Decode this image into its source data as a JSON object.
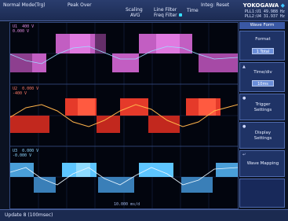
{
  "topbar": {
    "mode": "Normal Mode(Trg)",
    "peak": "Peak Over",
    "scaling": "Scaling",
    "avg": "AVG",
    "line_filter": "Line Filter",
    "freq_filter": "Freq Filter",
    "time": "Time",
    "integ": "Integ: Reset",
    "brand": "YOKOGAWA",
    "pll1": "PLL1:U1   49.988 Hz",
    "pll2": "PLL2:U4   31.937 Hz"
  },
  "channels": [
    {
      "name": "U1",
      "top_value": "400 V",
      "bottom_value": "0.000 V",
      "color": "#d25ad2"
    },
    {
      "name": "U2",
      "top_value": "0.000 V",
      "bottom_value": "-400 V",
      "color": "#ff3b2e"
    },
    {
      "name": "U3",
      "top_value": "0.000 V",
      "bottom_value": "-0.000 V",
      "color": "#5ec6ff"
    }
  ],
  "menu": {
    "title": "Wave Form",
    "items": [
      {
        "label": "Format",
        "value": "1 Total"
      },
      {
        "label": "Time/div",
        "value": "10ms"
      },
      {
        "label": "Trigger\nSettings"
      },
      {
        "label": "Display\nSettings"
      },
      {
        "label": "Wave Mapping"
      }
    ]
  },
  "scope": {
    "time_div": "10.000 ms/d"
  },
  "bottom": {
    "update": "Update   8 (100msec)"
  }
}
